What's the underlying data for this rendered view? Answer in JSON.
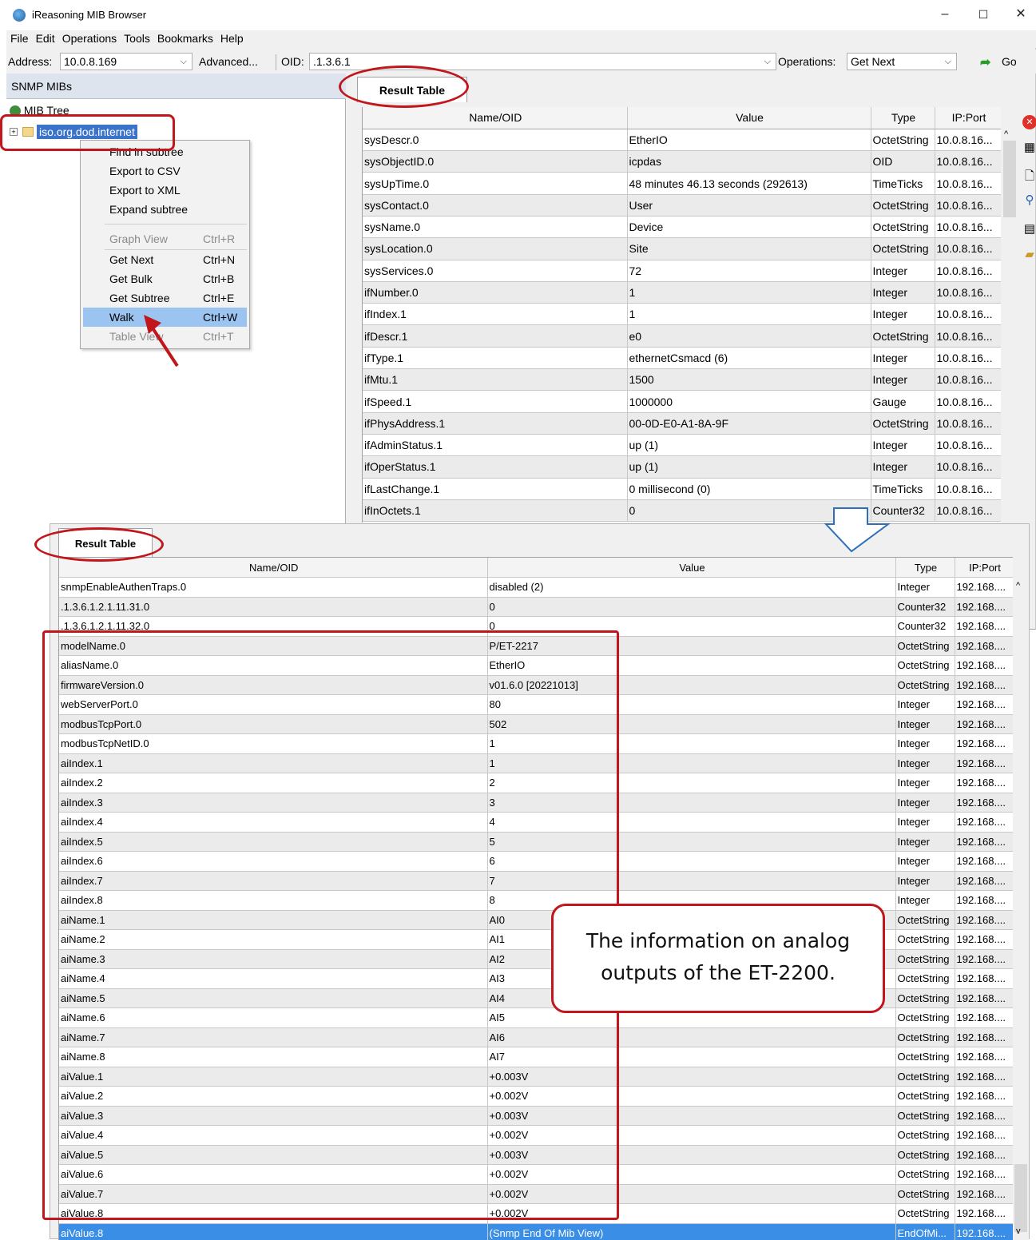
{
  "window": {
    "title": "iReasoning MIB Browser",
    "minimize": "–",
    "maximize": "☐",
    "close": "✕"
  },
  "menu": [
    "File",
    "Edit",
    "Operations",
    "Tools",
    "Bookmarks",
    "Help"
  ],
  "toolbar": {
    "address_label": "Address:",
    "address_value": "10.0.8.169",
    "advanced_label": "Advanced...",
    "oid_label": "OID:",
    "oid_value": ".1.3.6.1",
    "operations_label": "Operations:",
    "operations_value": "Get Next",
    "go_label": "Go"
  },
  "left_panel": {
    "header": "SNMP MIBs",
    "tree_root": "MIB Tree",
    "tree_node": "iso.org.dod.internet"
  },
  "context_menu": {
    "items": [
      {
        "label": "Find in subtree",
        "shortcut": ""
      },
      {
        "label": "Export to CSV",
        "shortcut": ""
      },
      {
        "label": "Export to XML",
        "shortcut": ""
      },
      {
        "label": "Expand subtree",
        "shortcut": ""
      },
      {
        "label": "Graph View",
        "shortcut": "Ctrl+R"
      },
      {
        "label": "Get Next",
        "shortcut": "Ctrl+N"
      },
      {
        "label": "Get Bulk",
        "shortcut": "Ctrl+B"
      },
      {
        "label": "Get Subtree",
        "shortcut": "Ctrl+E"
      },
      {
        "label": "Walk",
        "shortcut": "Ctrl+W"
      },
      {
        "label": "Table View",
        "shortcut": "Ctrl+T"
      }
    ]
  },
  "top_result": {
    "tab": "Result Table",
    "columns": [
      "Name/OID",
      "Value",
      "Type",
      "IP:Port"
    ],
    "rows": [
      [
        "sysDescr.0",
        "EtherIO",
        "OctetString",
        "10.0.8.16..."
      ],
      [
        "sysObjectID.0",
        "icpdas",
        "OID",
        "10.0.8.16..."
      ],
      [
        "sysUpTime.0",
        "48 minutes 46.13 seconds (292613)",
        "TimeTicks",
        "10.0.8.16..."
      ],
      [
        "sysContact.0",
        "User",
        "OctetString",
        "10.0.8.16..."
      ],
      [
        "sysName.0",
        "Device",
        "OctetString",
        "10.0.8.16..."
      ],
      [
        "sysLocation.0",
        "Site",
        "OctetString",
        "10.0.8.16..."
      ],
      [
        "sysServices.0",
        "72",
        "Integer",
        "10.0.8.16..."
      ],
      [
        "ifNumber.0",
        "1",
        "Integer",
        "10.0.8.16..."
      ],
      [
        "ifIndex.1",
        "1",
        "Integer",
        "10.0.8.16..."
      ],
      [
        "ifDescr.1",
        "e0",
        "OctetString",
        "10.0.8.16..."
      ],
      [
        "ifType.1",
        "ethernetCsmacd (6)",
        "Integer",
        "10.0.8.16..."
      ],
      [
        "ifMtu.1",
        "1500",
        "Integer",
        "10.0.8.16..."
      ],
      [
        "ifSpeed.1",
        "1000000",
        "Gauge",
        "10.0.8.16..."
      ],
      [
        "ifPhysAddress.1",
        "00-0D-E0-A1-8A-9F",
        "OctetString",
        "10.0.8.16..."
      ],
      [
        "ifAdminStatus.1",
        "up (1)",
        "Integer",
        "10.0.8.16..."
      ],
      [
        "ifOperStatus.1",
        "up (1)",
        "Integer",
        "10.0.8.16..."
      ],
      [
        "ifLastChange.1",
        "0 millisecond (0)",
        "TimeTicks",
        "10.0.8.16..."
      ],
      [
        "ifInOctets.1",
        "0",
        "Counter32",
        "10.0.8.16..."
      ]
    ]
  },
  "bottom_result": {
    "tab": "Result Table",
    "columns": [
      "Name/OID",
      "Value",
      "Type",
      "IP:Port"
    ],
    "rows": [
      [
        "snmpEnableAuthenTraps.0",
        "disabled (2)",
        "Integer",
        "192.168...."
      ],
      [
        ".1.3.6.1.2.1.11.31.0",
        "0",
        "Counter32",
        "192.168...."
      ],
      [
        ".1.3.6.1.2.1.11.32.0",
        "0",
        "Counter32",
        "192.168...."
      ],
      [
        "modelName.0",
        "P/ET-2217",
        "OctetString",
        "192.168...."
      ],
      [
        "aliasName.0",
        "EtherIO",
        "OctetString",
        "192.168...."
      ],
      [
        "firmwareVersion.0",
        "v01.6.0 [20221013]",
        "OctetString",
        "192.168...."
      ],
      [
        "webServerPort.0",
        "80",
        "Integer",
        "192.168...."
      ],
      [
        "modbusTcpPort.0",
        "502",
        "Integer",
        "192.168...."
      ],
      [
        "modbusTcpNetID.0",
        "1",
        "Integer",
        "192.168...."
      ],
      [
        "aiIndex.1",
        "1",
        "Integer",
        "192.168...."
      ],
      [
        "aiIndex.2",
        "2",
        "Integer",
        "192.168...."
      ],
      [
        "aiIndex.3",
        "3",
        "Integer",
        "192.168...."
      ],
      [
        "aiIndex.4",
        "4",
        "Integer",
        "192.168...."
      ],
      [
        "aiIndex.5",
        "5",
        "Integer",
        "192.168...."
      ],
      [
        "aiIndex.6",
        "6",
        "Integer",
        "192.168...."
      ],
      [
        "aiIndex.7",
        "7",
        "Integer",
        "192.168...."
      ],
      [
        "aiIndex.8",
        "8",
        "Integer",
        "192.168...."
      ],
      [
        "aiName.1",
        "AI0",
        "OctetString",
        "192.168...."
      ],
      [
        "aiName.2",
        "AI1",
        "OctetString",
        "192.168...."
      ],
      [
        "aiName.3",
        "AI2",
        "OctetString",
        "192.168...."
      ],
      [
        "aiName.4",
        "AI3",
        "OctetString",
        "192.168...."
      ],
      [
        "aiName.5",
        "AI4",
        "OctetString",
        "192.168...."
      ],
      [
        "aiName.6",
        "AI5",
        "OctetString",
        "192.168...."
      ],
      [
        "aiName.7",
        "AI6",
        "OctetString",
        "192.168...."
      ],
      [
        "aiName.8",
        "AI7",
        "OctetString",
        "192.168...."
      ],
      [
        "aiValue.1",
        "+0.003V",
        "OctetString",
        "192.168...."
      ],
      [
        "aiValue.2",
        "+0.002V",
        "OctetString",
        "192.168...."
      ],
      [
        "aiValue.3",
        "+0.003V",
        "OctetString",
        "192.168...."
      ],
      [
        "aiValue.4",
        "+0.002V",
        "OctetString",
        "192.168...."
      ],
      [
        "aiValue.5",
        "+0.003V",
        "OctetString",
        "192.168...."
      ],
      [
        "aiValue.6",
        "+0.002V",
        "OctetString",
        "192.168...."
      ],
      [
        "aiValue.7",
        "+0.002V",
        "OctetString",
        "192.168...."
      ],
      [
        "aiValue.8",
        "+0.002V",
        "OctetString",
        "192.168...."
      ],
      [
        "aiValue.8",
        "(Snmp End Of Mib View)",
        "EndOfMi...",
        "192.168...."
      ]
    ]
  },
  "callout": {
    "line1": "The information on analog",
    "line2": "outputs of the ET-2200."
  },
  "colors": {
    "annotation_red": "#c0161c",
    "selection_blue": "#3a8ee6",
    "menu_highlight": "#9cc4f0"
  },
  "icons": [
    "close-red-icon",
    "export-table-icon",
    "new-document-icon",
    "search-icon",
    "print-icon",
    "open-folder-icon",
    "go-arrow-icon"
  ]
}
